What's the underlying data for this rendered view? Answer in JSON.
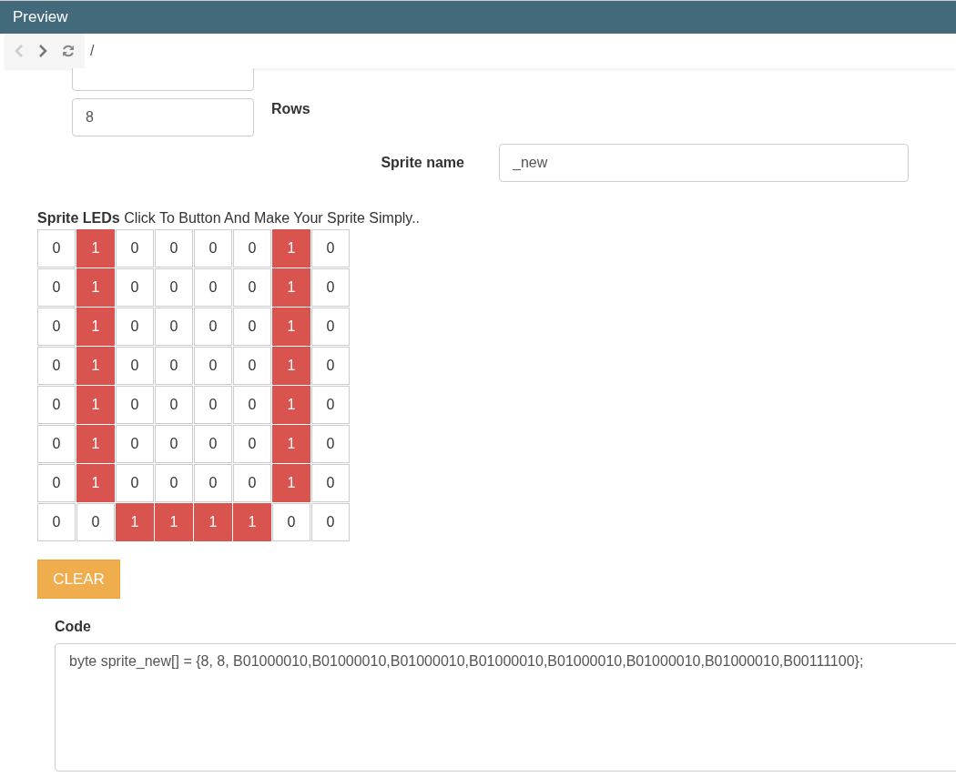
{
  "window": {
    "title": "Preview"
  },
  "nav": {
    "address": "/"
  },
  "form": {
    "rows_value": "8",
    "rows_label": "Rows",
    "sprite_name_label": "Sprite name",
    "sprite_name_value": "_new"
  },
  "leds": {
    "heading": "Sprite LEDs",
    "hint": "Click To Button And Make Your Sprite Simply..",
    "rows": [
      [
        {
          "label": "0",
          "on": false
        },
        {
          "label": "1",
          "on": true
        },
        {
          "label": "0",
          "on": false
        },
        {
          "label": "0",
          "on": false
        },
        {
          "label": "0",
          "on": false
        },
        {
          "label": "0",
          "on": false
        },
        {
          "label": "1",
          "on": true
        },
        {
          "label": "0",
          "on": false
        }
      ],
      [
        {
          "label": "0",
          "on": false
        },
        {
          "label": "1",
          "on": true
        },
        {
          "label": "0",
          "on": false
        },
        {
          "label": "0",
          "on": false
        },
        {
          "label": "0",
          "on": false
        },
        {
          "label": "0",
          "on": false
        },
        {
          "label": "1",
          "on": true
        },
        {
          "label": "0",
          "on": false
        }
      ],
      [
        {
          "label": "0",
          "on": false
        },
        {
          "label": "1",
          "on": true
        },
        {
          "label": "0",
          "on": false
        },
        {
          "label": "0",
          "on": false
        },
        {
          "label": "0",
          "on": false
        },
        {
          "label": "0",
          "on": false
        },
        {
          "label": "1",
          "on": true
        },
        {
          "label": "0",
          "on": false
        }
      ],
      [
        {
          "label": "0",
          "on": false
        },
        {
          "label": "1",
          "on": true
        },
        {
          "label": "0",
          "on": false
        },
        {
          "label": "0",
          "on": false
        },
        {
          "label": "0",
          "on": false
        },
        {
          "label": "0",
          "on": false
        },
        {
          "label": "1",
          "on": true
        },
        {
          "label": "0",
          "on": false
        }
      ],
      [
        {
          "label": "0",
          "on": false
        },
        {
          "label": "1",
          "on": true
        },
        {
          "label": "0",
          "on": false
        },
        {
          "label": "0",
          "on": false
        },
        {
          "label": "0",
          "on": false
        },
        {
          "label": "0",
          "on": false
        },
        {
          "label": "1",
          "on": true
        },
        {
          "label": "0",
          "on": false
        }
      ],
      [
        {
          "label": "0",
          "on": false
        },
        {
          "label": "1",
          "on": true
        },
        {
          "label": "0",
          "on": false
        },
        {
          "label": "0",
          "on": false
        },
        {
          "label": "0",
          "on": false
        },
        {
          "label": "0",
          "on": false
        },
        {
          "label": "1",
          "on": true
        },
        {
          "label": "0",
          "on": false
        }
      ],
      [
        {
          "label": "0",
          "on": false
        },
        {
          "label": "1",
          "on": true
        },
        {
          "label": "0",
          "on": false
        },
        {
          "label": "0",
          "on": false
        },
        {
          "label": "0",
          "on": false
        },
        {
          "label": "0",
          "on": false
        },
        {
          "label": "1",
          "on": true
        },
        {
          "label": "0",
          "on": false
        }
      ],
      [
        {
          "label": "0",
          "on": false
        },
        {
          "label": "0",
          "on": false
        },
        {
          "label": "1",
          "on": true
        },
        {
          "label": "1",
          "on": true
        },
        {
          "label": "1",
          "on": true
        },
        {
          "label": "1",
          "on": true
        },
        {
          "label": "0",
          "on": false
        },
        {
          "label": "0",
          "on": false
        }
      ]
    ],
    "clear_button": "CLEAR"
  },
  "code": {
    "label": "Code",
    "value": "byte sprite_new[] = {8, 8, B01000010,B01000010,B01000010,B01000010,B01000010,B01000010,B01000010,B00111100};"
  }
}
